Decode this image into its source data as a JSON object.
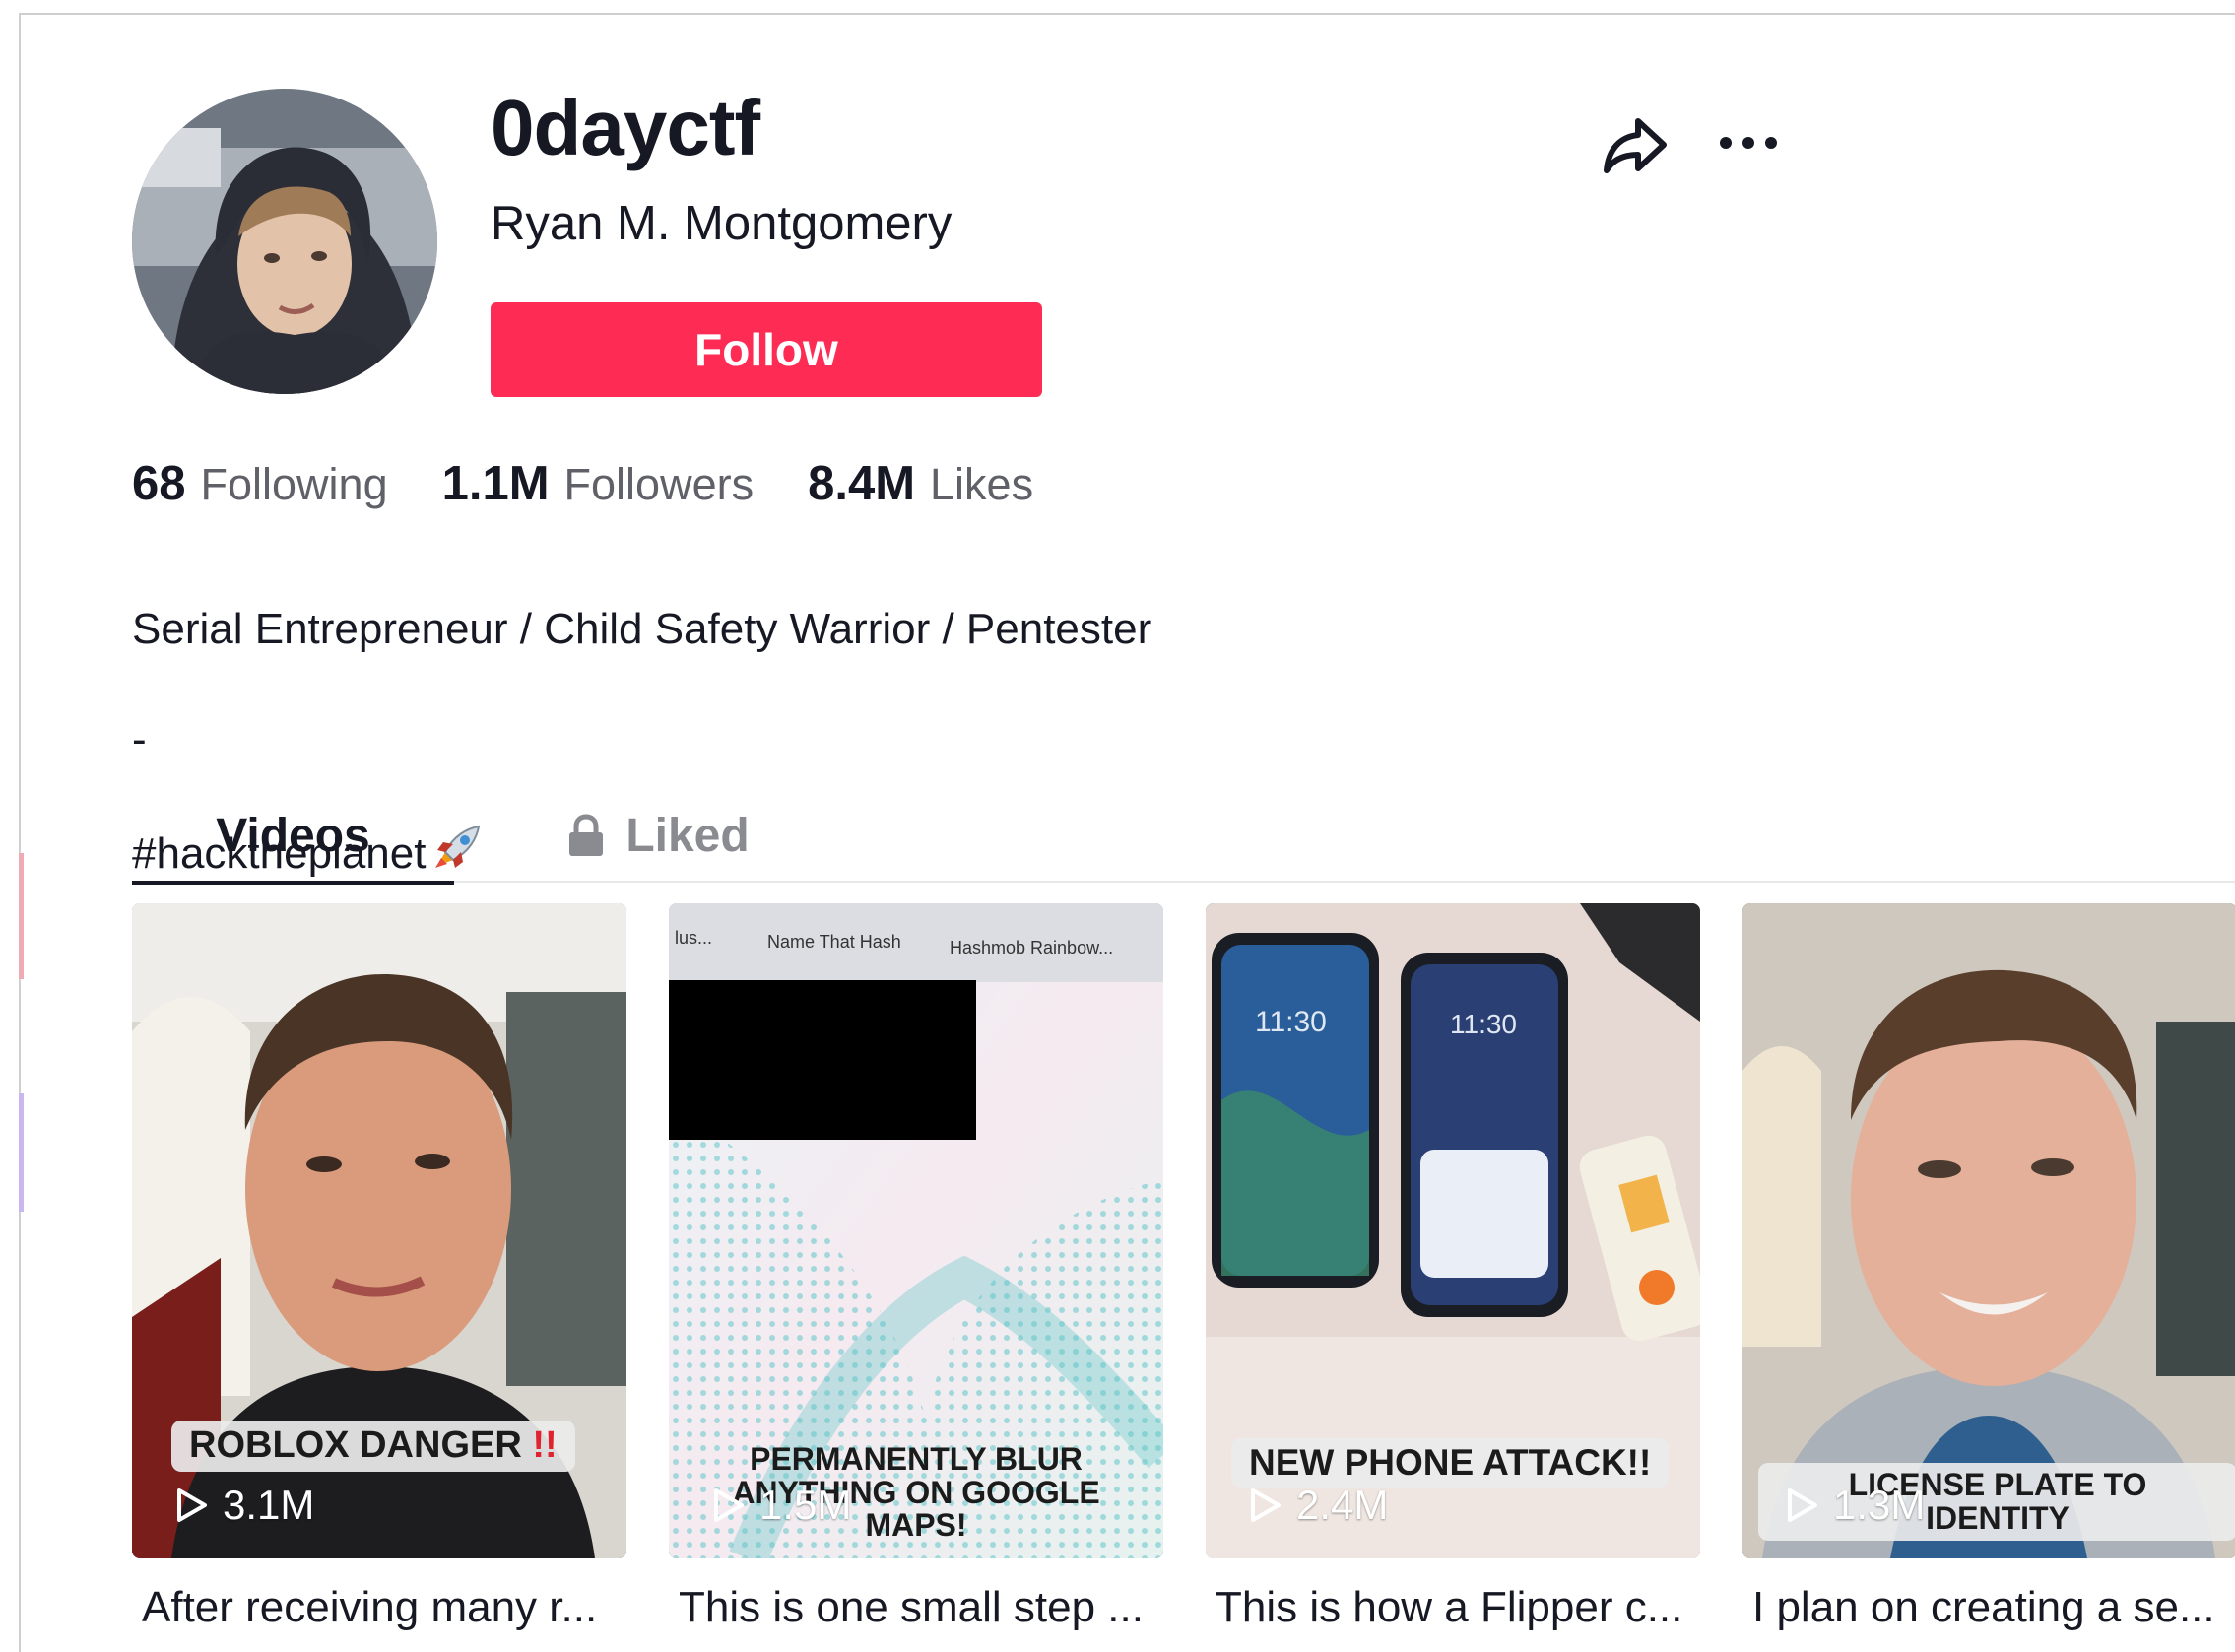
{
  "profile": {
    "username": "0dayctf",
    "nickname": "Ryan M. Montgomery",
    "follow_label": "Follow",
    "avatar_icon": "user-avatar-photo"
  },
  "actions": {
    "share_icon": "share-arrow-icon",
    "more_icon": "more-horizontal-icon"
  },
  "stats": [
    {
      "value": "68",
      "label": "Following"
    },
    {
      "value": "1.1M",
      "label": "Followers"
    },
    {
      "value": "8.4M",
      "label": "Likes"
    }
  ],
  "bio": {
    "line1": "Serial Entrepreneur / Child Safety Warrior / Pentester",
    "line2": "-",
    "line3": "#hacktheplanet",
    "emoji_icon": "rocket-emoji"
  },
  "tabs": [
    {
      "label": "Videos",
      "active": true
    },
    {
      "label": "Liked",
      "locked": true,
      "icon": "lock-icon"
    }
  ],
  "videos": [
    {
      "overlay": "ROBLOX DANGER ‼️",
      "overlay_main": "ROBLOX DANGER",
      "overlay_marks": "!!",
      "views": "3.1M",
      "caption": "After receiving many r..."
    },
    {
      "overlay_line1": "PERMANENTLY BLUR",
      "overlay_line2": "ANYTHING ON GOOGLE",
      "overlay_line3": "MAPS!",
      "tab_text_1": "Name That Hash",
      "tab_text_2": "Hashmob Rainbow...",
      "tab_text_0": "lus...",
      "views": "1.5M",
      "caption": "This is one small step ..."
    },
    {
      "overlay": "NEW PHONE ATTACK!!",
      "phone_time_1": "11:30",
      "phone_time_2": "11:30",
      "views": "2.4M",
      "caption": "This is how a Flipper c..."
    },
    {
      "overlay": "LICENSE PLATE TO IDENTITY",
      "views": "1.3M",
      "caption": "I plan on creating a se..."
    }
  ],
  "colors": {
    "accent": "#fe2c55",
    "text": "#161823",
    "secondary_text": "#5f6068"
  }
}
